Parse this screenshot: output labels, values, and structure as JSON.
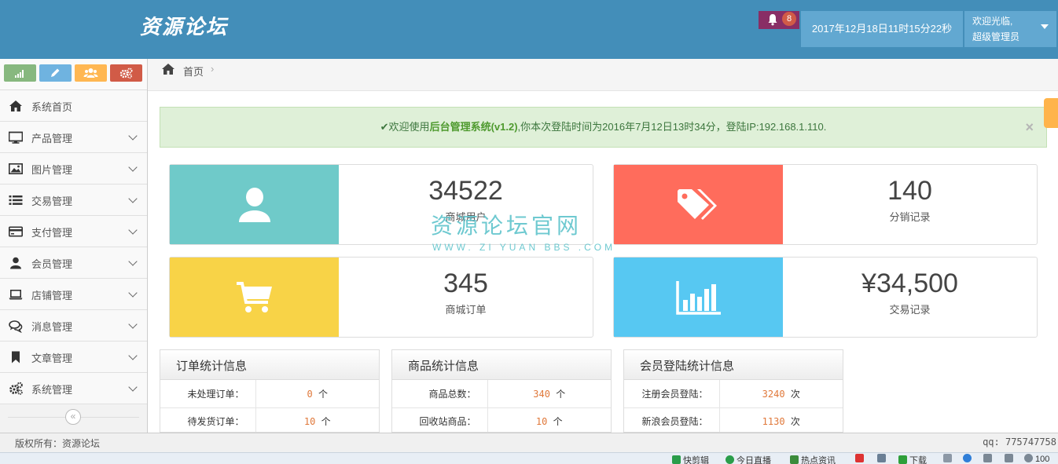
{
  "header": {
    "logo": "资源论坛",
    "notification_count": "8",
    "datetime": "2017年12月18日11时15分22秒",
    "welcome": "欢迎光临,",
    "role": "超级管理员"
  },
  "sidebar": {
    "shortcut_colors": [
      "#87b87f",
      "#6fb3e0",
      "#ffb752",
      "#d15b47"
    ],
    "items": [
      {
        "label": "系统首页",
        "icon": "home-icon"
      },
      {
        "label": "产品管理",
        "icon": "desktop-icon"
      },
      {
        "label": "图片管理",
        "icon": "picture-icon"
      },
      {
        "label": "交易管理",
        "icon": "list-icon"
      },
      {
        "label": "支付管理",
        "icon": "credit-card-icon"
      },
      {
        "label": "会员管理",
        "icon": "user-icon"
      },
      {
        "label": "店铺管理",
        "icon": "laptop-icon"
      },
      {
        "label": "消息管理",
        "icon": "comments-icon"
      },
      {
        "label": "文章管理",
        "icon": "bookmark-icon"
      },
      {
        "label": "系统管理",
        "icon": "cogs-icon"
      }
    ],
    "collapse_symbol": "«"
  },
  "breadcrumb": {
    "home": "首页",
    "separator": "›"
  },
  "alert": {
    "prefix": "欢迎使用",
    "strong": "后台管理系统(v1.2)",
    "suffix": ",你本次登陆时间为2016年7月12日13时34分，登陆IP:192.168.1.110.",
    "close": "×"
  },
  "cards": [
    {
      "value": "34522",
      "label": "商城用户",
      "color": "#6fcac9",
      "icon": "user-icon"
    },
    {
      "value": "140",
      "label": "分销记录",
      "color": "#ff6c5c",
      "icon": "tags-icon"
    },
    {
      "value": "345",
      "label": "商城订单",
      "color": "#f8d347",
      "icon": "cart-icon"
    },
    {
      "value": "¥34,500",
      "label": "交易记录",
      "color": "#57c8f2",
      "icon": "bar-chart-icon"
    }
  ],
  "watermark": {
    "line1": "资源论坛官网",
    "line2": "WWW. ZI YUAN BBS .COM"
  },
  "panels": [
    {
      "title": "订单统计信息",
      "rows": [
        {
          "key": "未处理订单：",
          "num": "0",
          "unit": "个"
        },
        {
          "key": "待发货订单：",
          "num": "10",
          "unit": "个"
        }
      ]
    },
    {
      "title": "商品统计信息",
      "rows": [
        {
          "key": "商品总数：",
          "num": "340",
          "unit": "个"
        },
        {
          "key": "回收站商品：",
          "num": "10",
          "unit": "个"
        }
      ]
    },
    {
      "title": "会员登陆统计信息",
      "rows": [
        {
          "key": "注册会员登陆：",
          "num": "3240",
          "unit": "次"
        },
        {
          "key": "新浪会员登陆：",
          "num": "1130",
          "unit": "次"
        }
      ]
    }
  ],
  "footer": {
    "copyright": "版权所有：资源论坛",
    "qq": "qq: 775747758"
  },
  "statusbar": {
    "items": [
      "快剪辑",
      "今日直播",
      "热点资讯",
      "下载",
      "100"
    ]
  }
}
